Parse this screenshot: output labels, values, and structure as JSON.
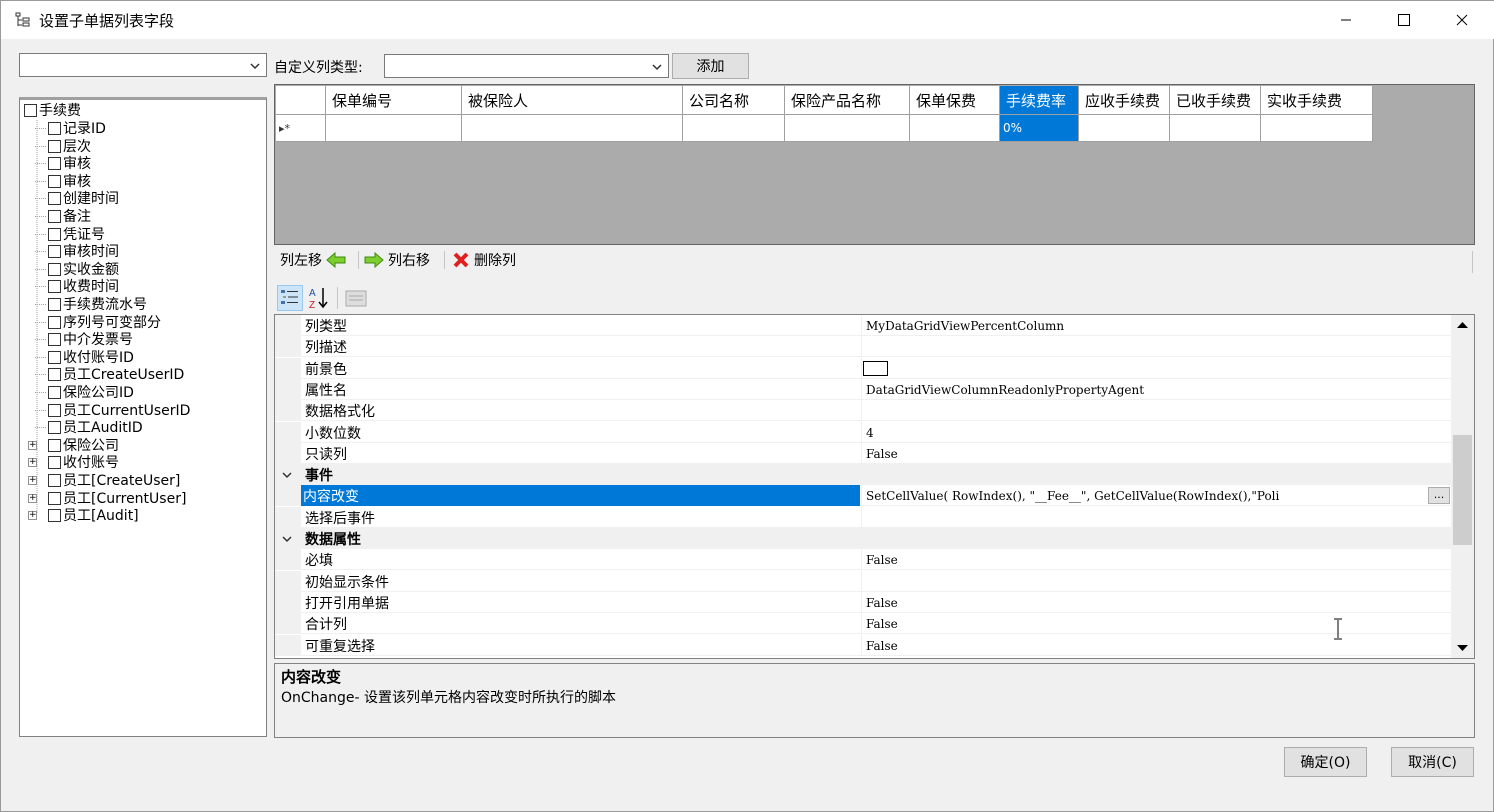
{
  "window": {
    "title": "设置子单据列表字段",
    "minimize_icon": "minimize-icon",
    "maximize_icon": "maximize-icon",
    "close_icon": "close-icon"
  },
  "top": {
    "left_combo_value": "",
    "custom_type_label": "自定义列类型:",
    "custom_type_value": "",
    "add_button": "添加"
  },
  "tree": {
    "root": "手续费",
    "items": [
      "记录ID",
      "层次",
      "审核",
      "审核",
      "创建时间",
      "备注",
      "凭证号",
      "审核时间",
      "实收金额",
      "收费时间",
      "手续费流水号",
      "序列号可变部分",
      "中介发票号",
      "收付账号ID",
      "员工CreateUserID",
      "保险公司ID",
      "员工CurrentUserID",
      "员工AuditID"
    ],
    "expandable": [
      "保险公司",
      "收付账号",
      "员工[CreateUser]",
      "员工[CurrentUser]",
      "员工[Audit]"
    ]
  },
  "grid": {
    "columns": [
      "保单编号",
      "被保险人",
      "公司名称",
      "保险产品名称",
      "保单保费",
      "手续费率",
      "应收手续费",
      "已收手续费",
      "实收手续费"
    ],
    "selected_column": "手续费率",
    "new_row_marker": "▸*",
    "percent_cell": "0%"
  },
  "toolstrip": {
    "move_left": "列左移",
    "move_right": "列右移",
    "delete": "删除列"
  },
  "properties": {
    "rows_top": [
      {
        "name": "列类型",
        "value": "MyDataGridViewPercentColumn"
      },
      {
        "name": "列描述",
        "value": ""
      },
      {
        "name": "前景色",
        "value": ""
      },
      {
        "name": "属性名",
        "value": "DataGridViewColumnReadonlyPropertyAgent"
      },
      {
        "name": "数据格式化",
        "value": ""
      },
      {
        "name": "小数位数",
        "value": "4"
      },
      {
        "name": "只读列",
        "value": "False"
      }
    ],
    "category_events": "事件",
    "rows_events": [
      {
        "name": "内容改变",
        "value": "SetCellValue(    RowIndex(),    \"__Fee__\",    GetCellValue(RowIndex(),\"Poli"
      },
      {
        "name": "选择后事件",
        "value": ""
      }
    ],
    "category_data": "数据属性",
    "rows_data": [
      {
        "name": "必填",
        "value": "False"
      },
      {
        "name": "初始显示条件",
        "value": ""
      },
      {
        "name": "打开引用单据",
        "value": "False"
      },
      {
        "name": "合计列",
        "value": "False"
      },
      {
        "name": "可重复选择",
        "value": "False"
      }
    ],
    "ellipsis": "..."
  },
  "description": {
    "title": "内容改变",
    "text": "OnChange- 设置该列单元格内容改变时所执行的脚本"
  },
  "buttons": {
    "ok": "确定(O)",
    "cancel": "取消(C)"
  },
  "colors": {
    "selection": "#0078d7",
    "grid_background": "#ababab"
  }
}
